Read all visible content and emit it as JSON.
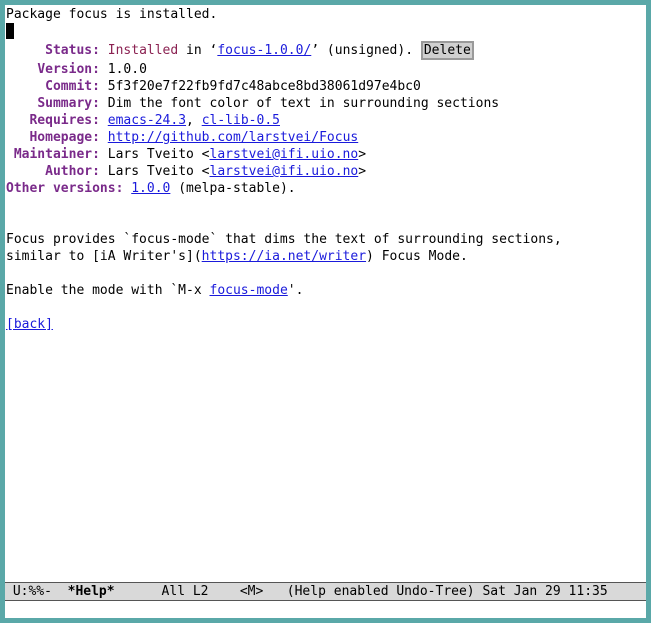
{
  "message": "Package focus is installed.",
  "fields": {
    "status_label": "Status:",
    "status_value": "Installed",
    "status_in": " in ‘",
    "status_dir": "focus-1.0.0/",
    "status_tail": "’ (unsigned). ",
    "delete_label": "Delete",
    "version_label": "Version:",
    "version_value": "1.0.0",
    "commit_label": "Commit:",
    "commit_value": "5f3f20e7f22fb9fd7c48abce8bd38061d97e4bc0",
    "summary_label": "Summary:",
    "summary_value": "Dim the font color of text in surrounding sections",
    "requires_label": "Requires:",
    "requires_1": "emacs-24.3",
    "requires_sep": ", ",
    "requires_2": "cl-lib-0.5",
    "homepage_label": "Homepage:",
    "homepage_value": "http://github.com/larstvei/Focus",
    "maintainer_label": "Maintainer:",
    "maintainer_name": "Lars Tveito <",
    "maintainer_email": "larstvei@ifi.uio.no",
    "maintainer_close": ">",
    "author_label": "Author:",
    "author_name": "Lars Tveito <",
    "author_email": "larstvei@ifi.uio.no",
    "author_close": ">",
    "other_label": "Other versions:",
    "other_link": "1.0.0",
    "other_tail": " (melpa-stable)."
  },
  "description": {
    "line1": "Focus provides `focus-mode` that dims the text of surrounding sections,",
    "line2_pre": "similar to [iA Writer's](",
    "line2_link": "https://ia.net/writer",
    "line2_post": ") Focus Mode.",
    "line3_pre": "Enable the mode with `M-x ",
    "line3_link": "focus-mode",
    "line3_post": "'.",
    "back": "[back]"
  },
  "modeline": {
    "state": " U:%%-  ",
    "buffer": "*Help*",
    "position": "      All L2    <M>   ",
    "modes": "(Help enabled Undo-Tree) Sat Jan 29 11:35"
  }
}
